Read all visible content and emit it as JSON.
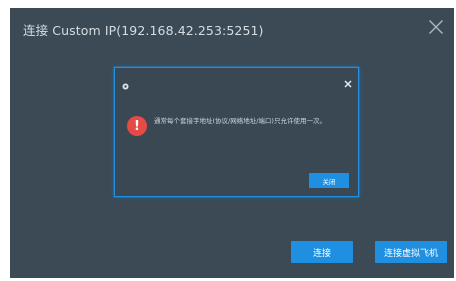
{
  "window": {
    "title": "连接 Custom IP(192.168.42.253:5251)",
    "close_icon": "close-icon"
  },
  "footer": {
    "connect_label": "连接",
    "connect_vm_label": "连接虚拟飞机"
  },
  "alert": {
    "logo_icon": "app-logo-icon",
    "close_icon": "close-icon",
    "error_icon": "error-icon",
    "error_symbol": "!",
    "message": "通常每个套接字地址(协议/网络地址/端口)只允许使用一次。",
    "ok_label": "关闭"
  },
  "colors": {
    "background": "#3b4a55",
    "accent": "#1e8fe1",
    "error": "#e64a45"
  }
}
